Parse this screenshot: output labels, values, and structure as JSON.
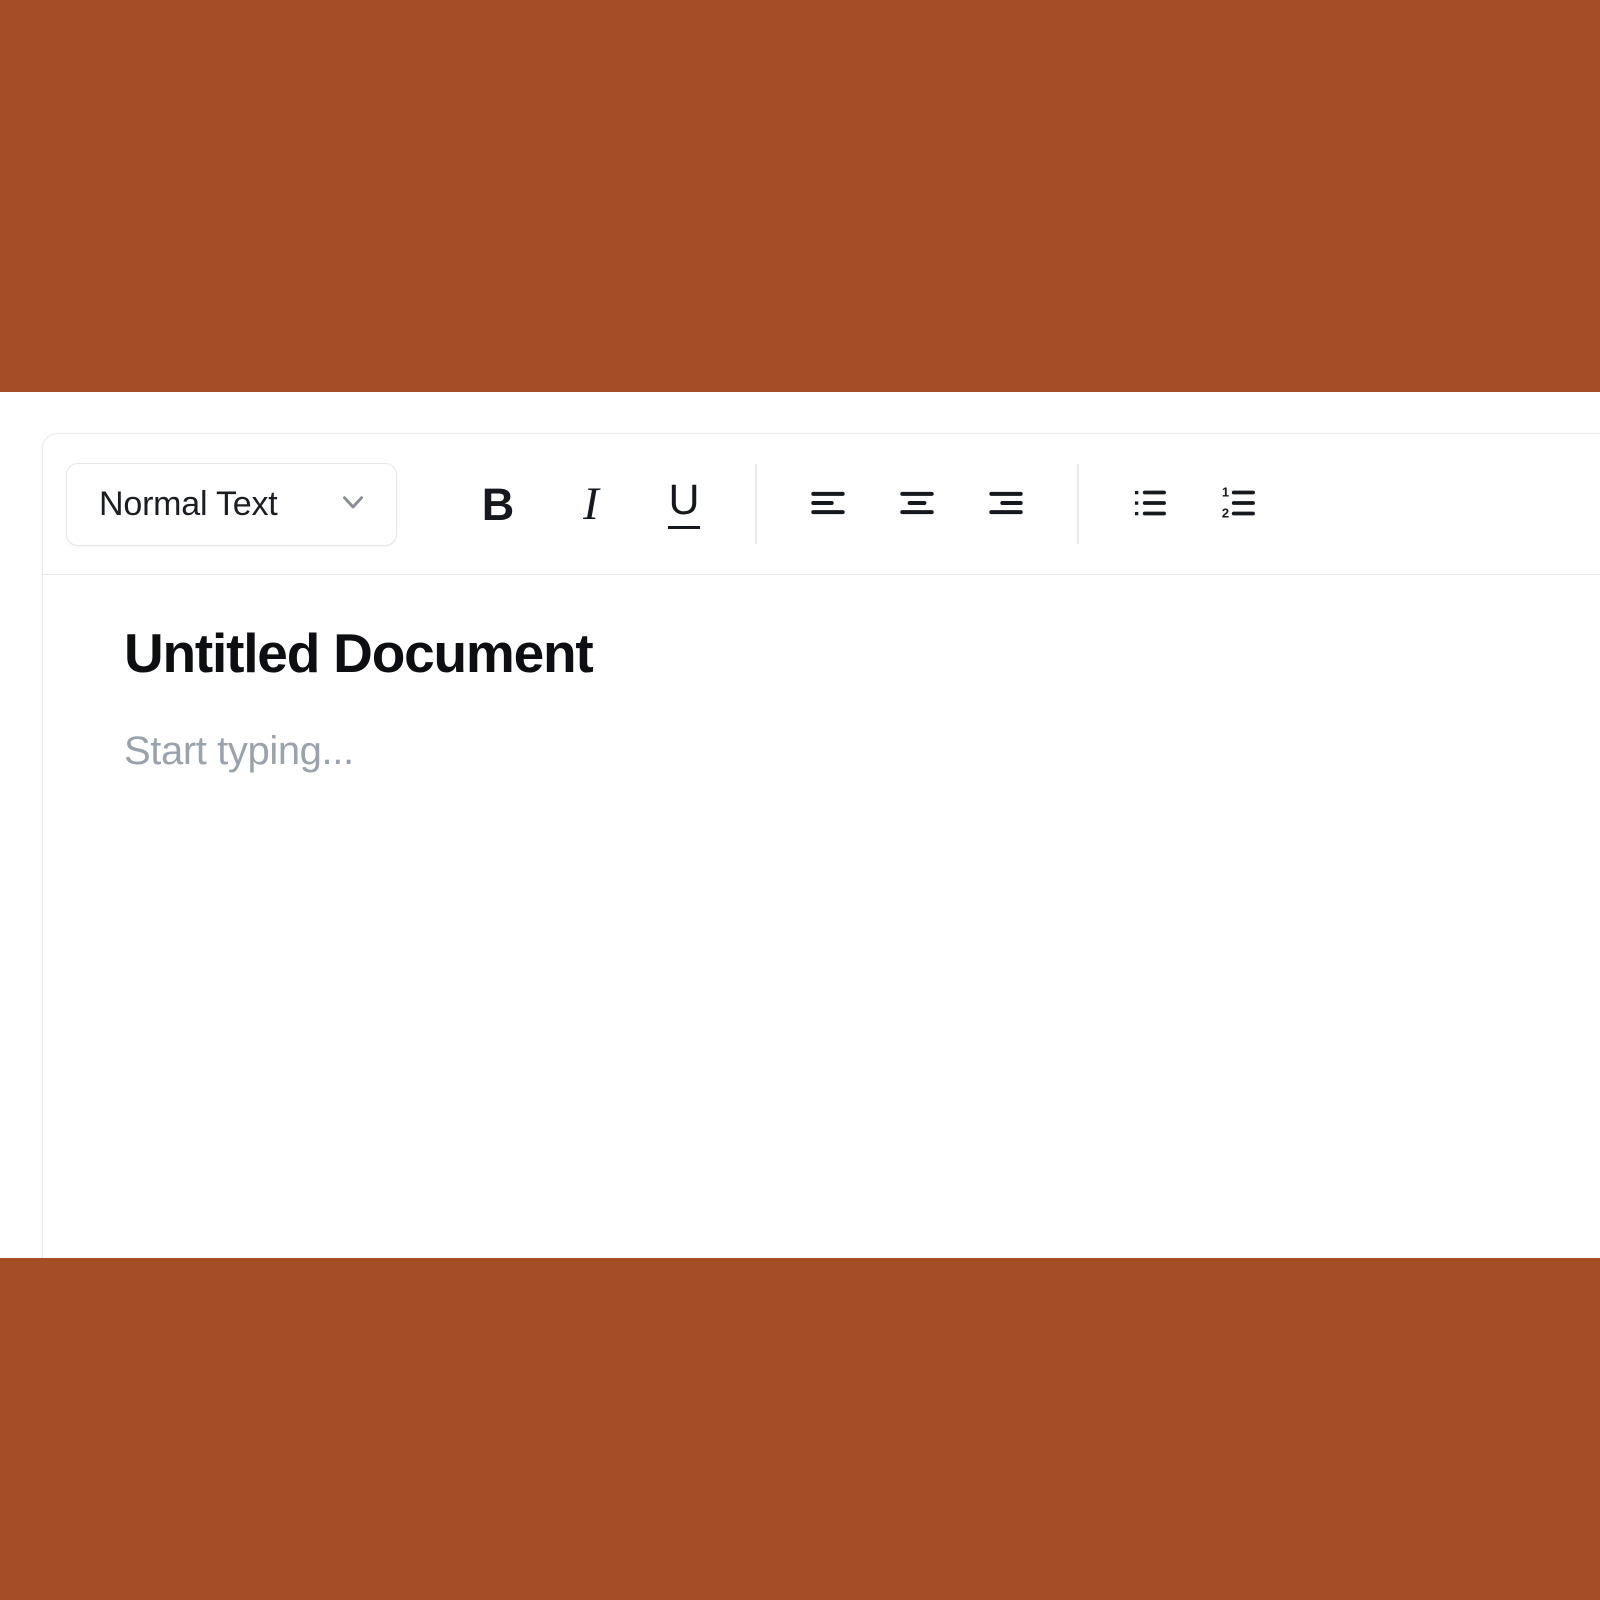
{
  "theme": {
    "page_background": "#A44D26",
    "card_background": "#FFFFFF",
    "card_border": "#E9EAEC",
    "icon_color": "#15181C",
    "title_color": "#0C0E11",
    "placeholder_color": "#9AA3AD",
    "separator_color": "#E9EAEC"
  },
  "toolbar": {
    "style_dropdown": {
      "name": "style-dropdown",
      "selected": "Normal Text",
      "chevron_icon": "chevron-down-icon"
    },
    "text_format_group": [
      {
        "icon": "bold-icon",
        "label": "B",
        "title": "Bold",
        "active": false
      },
      {
        "icon": "italic-icon",
        "label": "I",
        "title": "Italic",
        "active": false
      },
      {
        "icon": "underline-icon",
        "label": "U",
        "title": "Underline",
        "active": false
      }
    ],
    "alignment_group": [
      {
        "icon": "align-left-icon",
        "title": "Align left",
        "active": false
      },
      {
        "icon": "align-center-icon",
        "title": "Align center",
        "active": false
      },
      {
        "icon": "align-right-icon",
        "title": "Align right",
        "active": false
      }
    ],
    "list_group": [
      {
        "icon": "bulleted-list-icon",
        "title": "Bulleted list",
        "active": false
      },
      {
        "icon": "numbered-list-icon",
        "title": "Numbered list",
        "active": false
      }
    ],
    "numbered_list_digits": [
      "1",
      "2"
    ]
  },
  "document": {
    "title": "Untitled Document",
    "body_placeholder": "Start typing...",
    "body_value": ""
  }
}
